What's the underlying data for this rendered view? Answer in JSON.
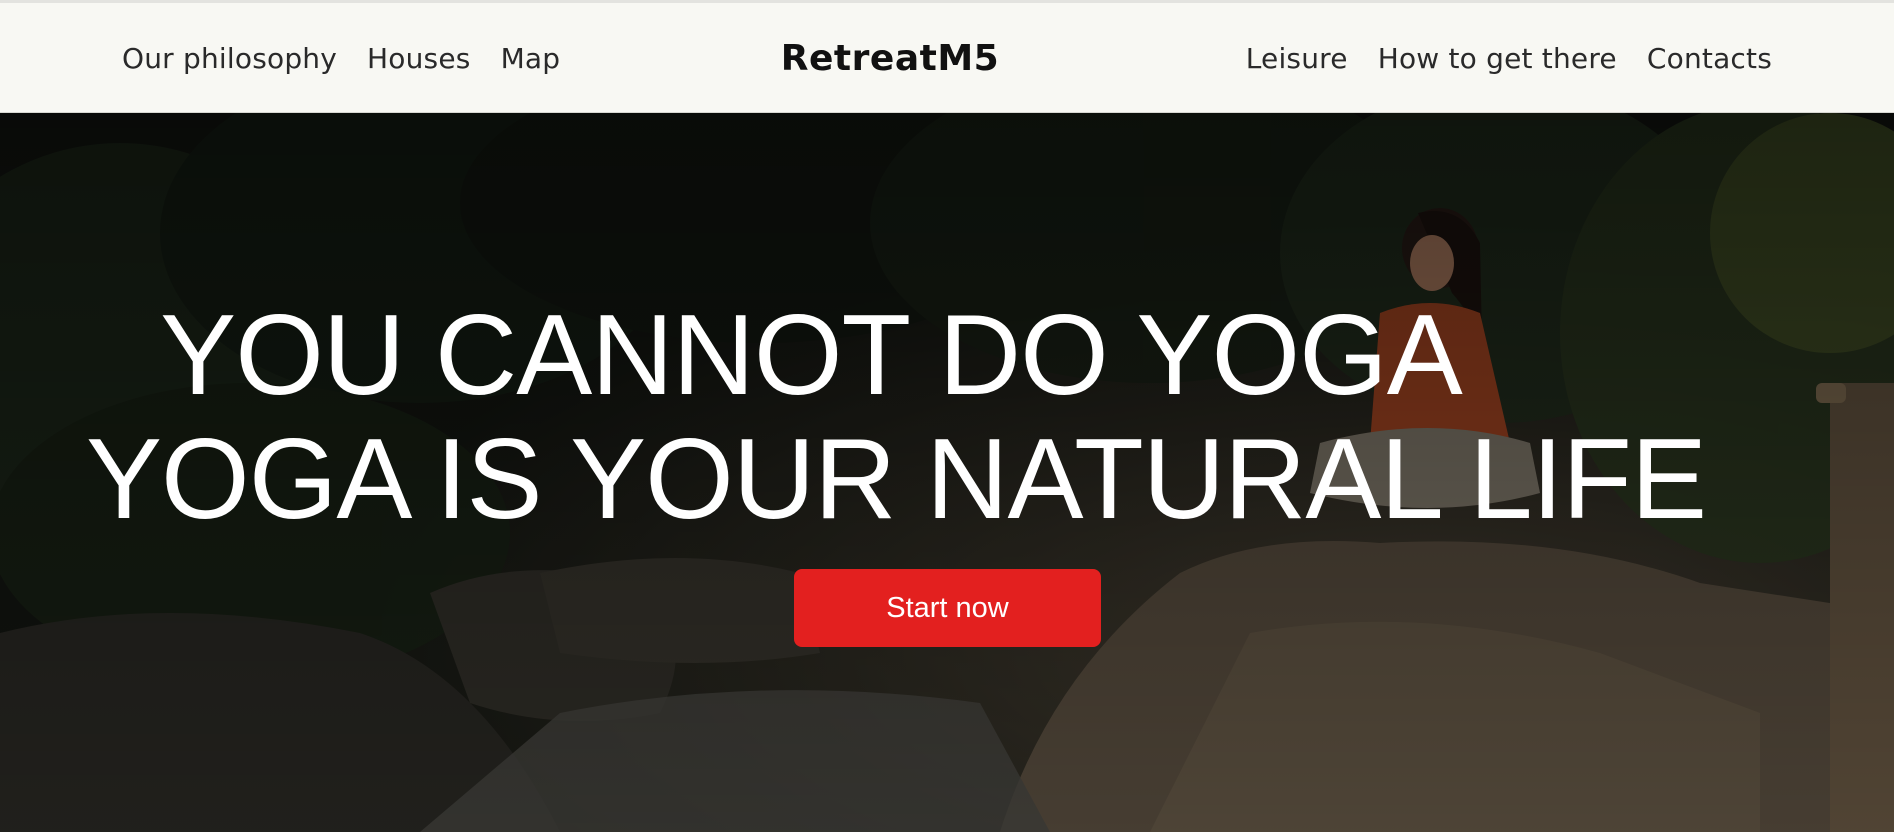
{
  "header": {
    "nav_left": [
      "Our philosophy",
      "Houses",
      "Map"
    ],
    "logo": "RetreatM5",
    "nav_right": [
      "Leisure",
      "How to get there",
      "Contacts"
    ]
  },
  "hero": {
    "headline_line1": "YOU CANNOT DO YOGA",
    "headline_line2": "YOGA IS YOUR NATURAL LIFE",
    "cta_label": "Start now",
    "background_image": "person-meditating-on-rock-in-forest"
  },
  "colors": {
    "header_bg": "#f8f8f3",
    "cta_bg": "#e3201f",
    "headline_text": "#ffffff"
  }
}
